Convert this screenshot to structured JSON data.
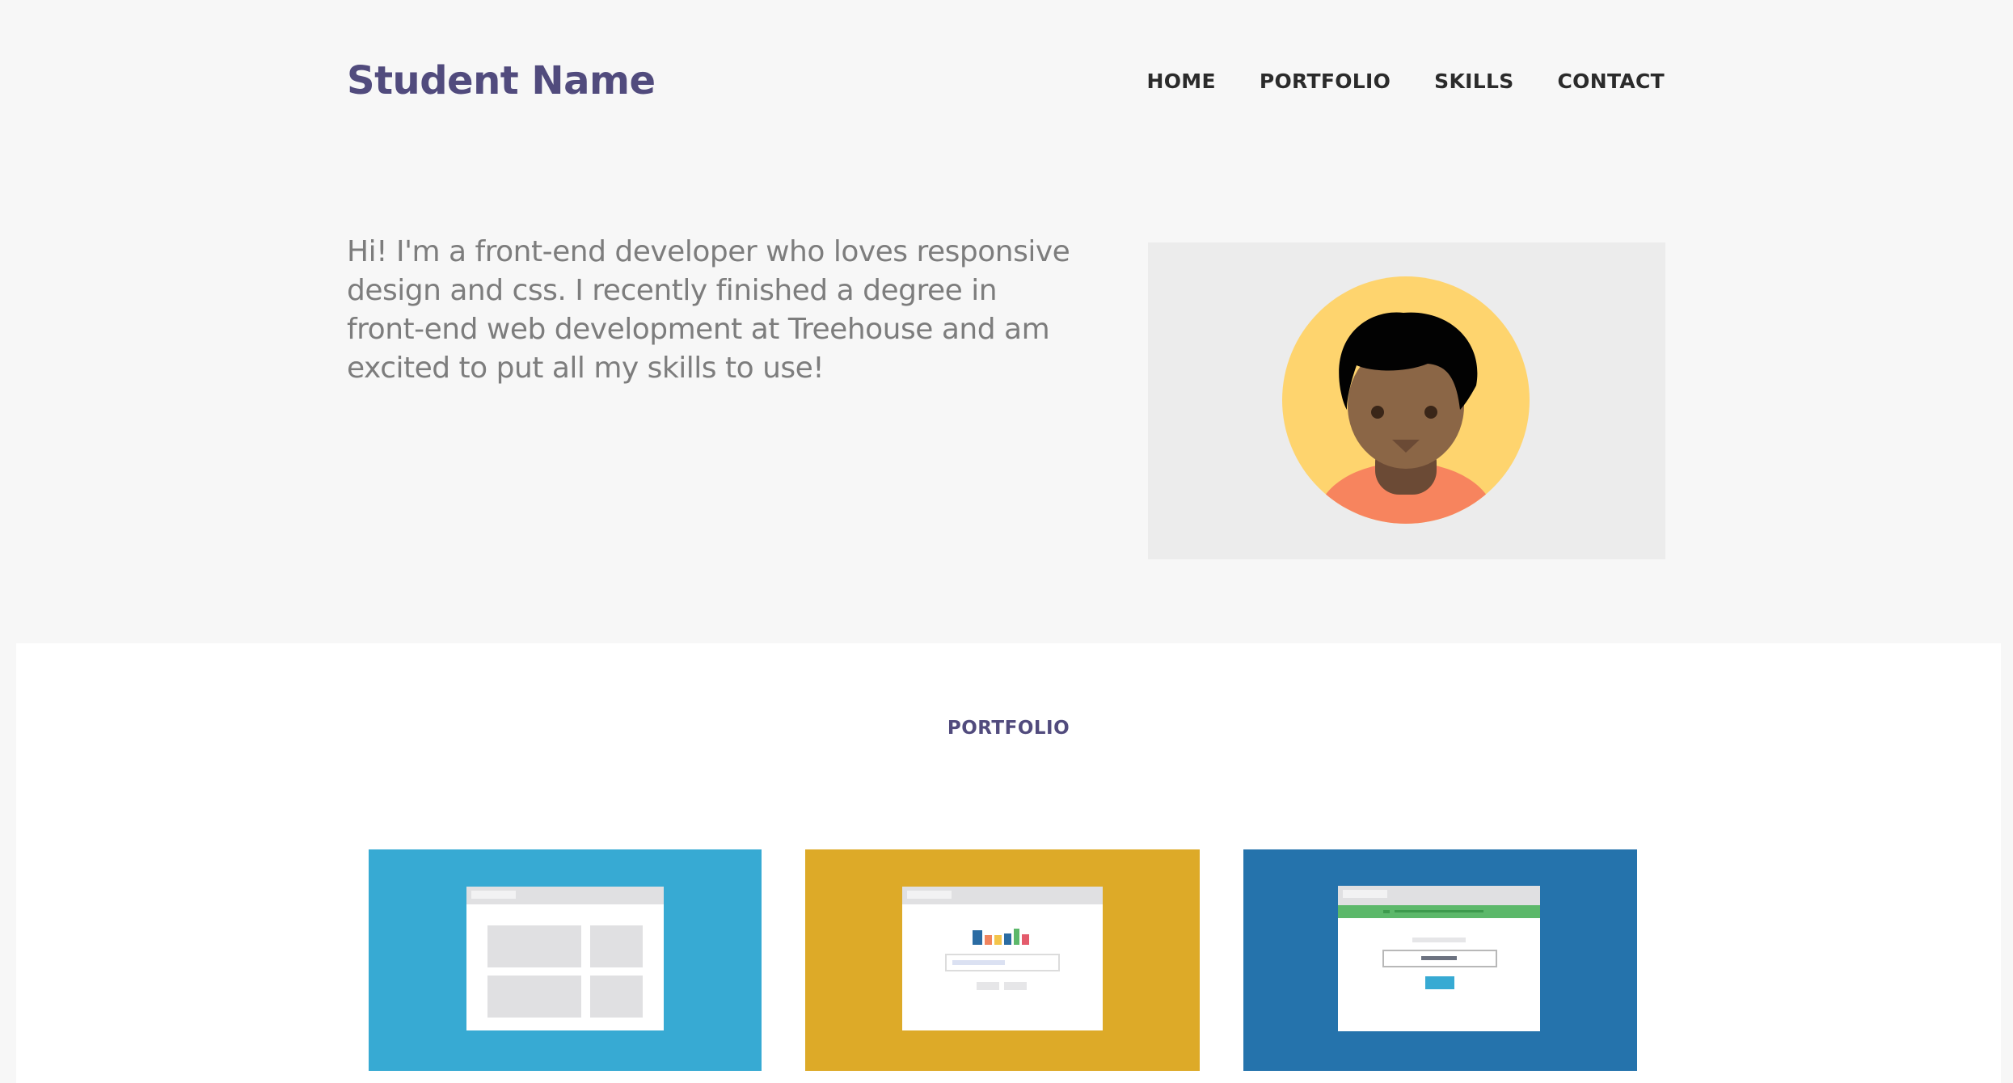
{
  "header": {
    "brand": "Student Name",
    "nav": [
      "HOME",
      "PORTFOLIO",
      "SKILLS",
      "CONTACT"
    ]
  },
  "intro": {
    "text": "Hi! I'm a front-end developer who loves responsive design and css. I recently finished a degree in front-end web development at Treehouse and am excited to put all my skills to use!"
  },
  "portfolio": {
    "title": "PORTFOLIO",
    "cards": [
      {
        "color": "#37aad3",
        "icon": "layout-grid-icon"
      },
      {
        "color": "#ddaa28",
        "icon": "bar-chart-form-icon"
      },
      {
        "color": "#2573ac",
        "icon": "signup-form-icon"
      }
    ]
  },
  "colors": {
    "brand": "#514b7d",
    "page_bg": "#f7f7f7",
    "avatar_bg": "#ececec"
  }
}
